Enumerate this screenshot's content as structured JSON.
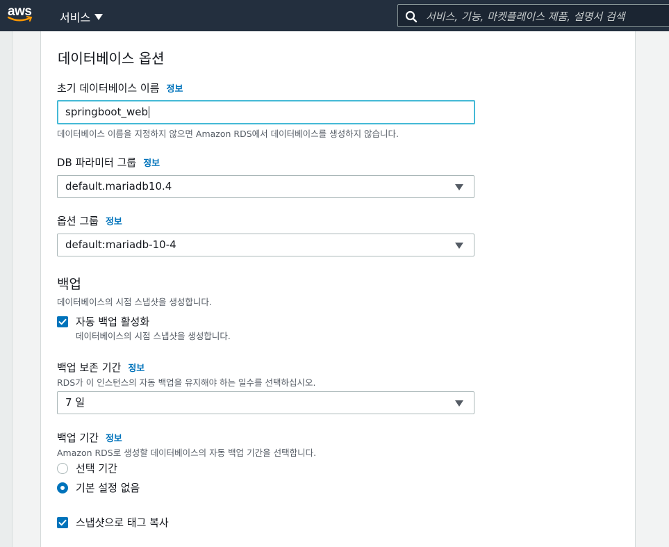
{
  "header": {
    "logo_text": "aws",
    "services_label": "서비스",
    "search_placeholder": "서비스, 기능, 마켓플레이스 제품, 설명서 검색"
  },
  "section": {
    "title": "데이터베이스 옵션"
  },
  "initial_db": {
    "label": "초기 데이터베이스 이름",
    "info": "정보",
    "value": "springboot_web",
    "hint": "데이터베이스 이름을 지정하지 않으면 Amazon RDS에서 데이터베이스를 생성하지 않습니다."
  },
  "param_group": {
    "label": "DB 파라미터 그룹",
    "info": "정보",
    "selected": "default.mariadb10.4"
  },
  "option_group": {
    "label": "옵션 그룹",
    "info": "정보",
    "selected": "default:mariadb-10-4"
  },
  "backup": {
    "title": "백업",
    "desc": "데이터베이스의 시점 스냅샷을 생성합니다.",
    "auto_backup_label": "자동 백업 활성화",
    "auto_backup_desc": "데이터베이스의 시점 스냅샷을 생성합니다.",
    "auto_backup_checked": true
  },
  "retention": {
    "label": "백업 보존 기간",
    "info": "정보",
    "desc": "RDS가 이 인스턴스의 자동 백업을 유지해야 하는 일수를 선택하십시오.",
    "selected": "7 일"
  },
  "window": {
    "label": "백업 기간",
    "info": "정보",
    "desc": "Amazon RDS로 생성할 데이터베이스의 자동 백업 기간을 선택합니다.",
    "options": [
      {
        "label": "선택 기간",
        "selected": false
      },
      {
        "label": "기본 설정 없음",
        "selected": true
      }
    ]
  },
  "copy_tags": {
    "label": "스냅샷으로 태그 복사",
    "checked": true
  },
  "colors": {
    "nav_bg": "#232f3e",
    "accent": "#0073bb",
    "focus": "#44b9d6"
  }
}
